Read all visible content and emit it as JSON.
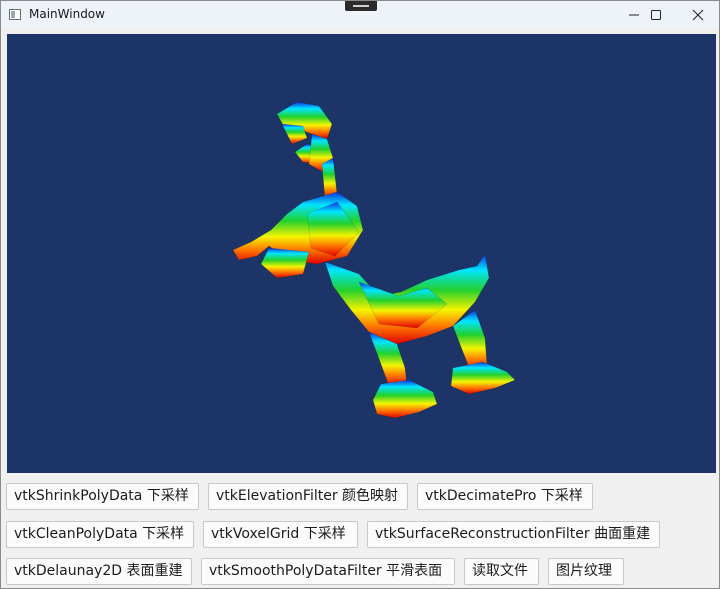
{
  "window": {
    "title": "MainWindow"
  },
  "titlebar_controls": {
    "minimize_icon": "minimize-icon",
    "maximize_icon": "maximize-icon",
    "close_icon": "close-icon"
  },
  "viewport": {
    "background_color": "#1c3467",
    "model_colors": [
      "#0b2fe0",
      "#00e5ff",
      "#22d12e",
      "#f4f400",
      "#ff7a00",
      "#e00000"
    ]
  },
  "buttons": {
    "row1": [
      "vtkShrinkPolyData 下采样",
      "vtkElevationFilter 颜色映射",
      "vtkDecimatePro 下采样"
    ],
    "row2": [
      "vtkCleanPolyData 下采样",
      "vtkVoxelGrid 下采样",
      "vtkSurfaceReconstructionFilter 曲面重建"
    ],
    "row3": [
      "vtkDelaunay2D 表面重建",
      "vtkSmoothPolyDataFilter 平滑表面",
      "读取文件",
      "图片纹理"
    ]
  }
}
